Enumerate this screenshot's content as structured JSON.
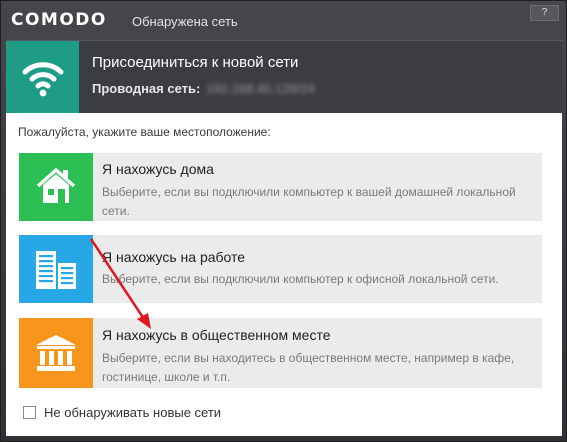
{
  "window": {
    "brand": "COMODO",
    "title": "Обнаружена сеть",
    "help_label": "?"
  },
  "header": {
    "icon": "wifi-icon",
    "title": "Присоединиться к новой сети",
    "network_label": "Проводная сеть:",
    "network_value": "192.168.40.128/24"
  },
  "main": {
    "prompt": "Пожалуйста, укажите ваше местоположение:",
    "options": [
      {
        "icon": "home-icon",
        "title": "Я нахожусь дома",
        "description": "Выберите, если вы подключили компьютер к вашей домашней локальной сети.",
        "color": "#2cbf54"
      },
      {
        "icon": "office-building-icon",
        "title": "Я нахожусь на работе",
        "description": "Выберите, если вы подключили компьютер к офисной локальной сети.",
        "color": "#27a7e6"
      },
      {
        "icon": "public-building-icon",
        "title": "Я нахожусь в общественном месте",
        "description": "Выберите, если вы находитесь в общественном месте, например в кафе, гостинице, школе и т.п.",
        "color": "#f7951d"
      }
    ],
    "dont_detect_label": "Не обнаруживать новые сети",
    "dont_detect_checked": false
  },
  "colors": {
    "accent_teal": "#1f9c86",
    "annotation_arrow": "#e0171f"
  }
}
